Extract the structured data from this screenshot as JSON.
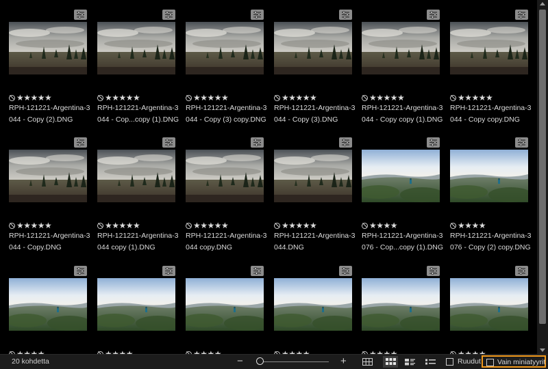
{
  "status": {
    "count": "20 kohdetta",
    "zoom_minus": "−",
    "zoom_plus": "+",
    "tiles_label": "Ruudut",
    "thumbs_only_label": "Vain miniatyyrit",
    "highlight_color": "#f39a1c"
  },
  "icons": {
    "adjustment": "adjustment-sliders-icon",
    "reject": "reject-flag-icon",
    "view_details": "grid-details-view-icon",
    "view_thumbs": "grid-thumbnails-view-icon",
    "view_filmstrip": "filmstrip-view-icon",
    "view_list": "list-view-icon"
  },
  "photos": [
    {
      "line1": "RPH-121221-Argentina-3",
      "line2": "044 - Copy (2).DNG",
      "stars": "★★★★★",
      "scene": "field"
    },
    {
      "line1": "RPH-121221-Argentina-3",
      "line2": "044 - Cop...copy (1).DNG",
      "stars": "★★★★★",
      "scene": "field"
    },
    {
      "line1": "RPH-121221-Argentina-3",
      "line2": "044 - Copy (3) copy.DNG",
      "stars": "★★★★★",
      "scene": "field"
    },
    {
      "line1": "RPH-121221-Argentina-3",
      "line2": "044 - Copy (3).DNG",
      "stars": "★★★★★",
      "scene": "field"
    },
    {
      "line1": "RPH-121221-Argentina-3",
      "line2": "044 - Copy copy (1).DNG",
      "stars": "★★★★★",
      "scene": "field"
    },
    {
      "line1": "RPH-121221-Argentina-3",
      "line2": "044 - Copy copy.DNG",
      "stars": "★★★★★",
      "scene": "field"
    },
    {
      "line1": "RPH-121221-Argentina-3",
      "line2": "044 - Copy.DNG",
      "stars": "★★★★★",
      "scene": "field"
    },
    {
      "line1": "RPH-121221-Argentina-3",
      "line2": "044 copy (1).DNG",
      "stars": "★★★★★",
      "scene": "field"
    },
    {
      "line1": "RPH-121221-Argentina-3",
      "line2": "044 copy.DNG",
      "stars": "★★★★★",
      "scene": "field"
    },
    {
      "line1": "RPH-121221-Argentina-3",
      "line2": "044.DNG",
      "stars": "★★★★★",
      "scene": "field"
    },
    {
      "line1": "RPH-121221-Argentina-3",
      "line2": "076 - Cop...copy (1).DNG",
      "stars": "★★★★",
      "scene": "valley"
    },
    {
      "line1": "RPH-121221-Argentina-3",
      "line2": "076 - Copy (2) copy.DNG",
      "stars": "★★★★",
      "scene": "valley"
    },
    {
      "line1": "",
      "line2": "",
      "stars": "★★★★",
      "scene": "valley"
    },
    {
      "line1": "",
      "line2": "",
      "stars": "★★★★",
      "scene": "valley"
    },
    {
      "line1": "",
      "line2": "",
      "stars": "★★★★",
      "scene": "valley"
    },
    {
      "line1": "",
      "line2": "",
      "stars": "★★★★",
      "scene": "valley"
    },
    {
      "line1": "",
      "line2": "",
      "stars": "★★★★",
      "scene": "valley"
    },
    {
      "line1": "",
      "line2": "",
      "stars": "★★★★",
      "scene": "valley"
    }
  ]
}
